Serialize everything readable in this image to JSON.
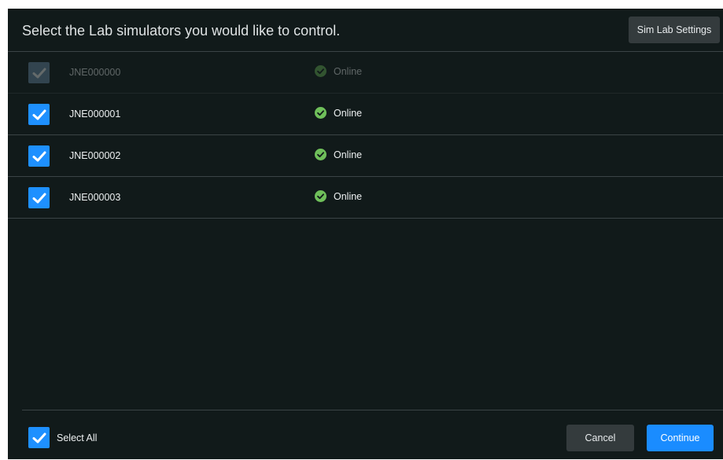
{
  "dialog": {
    "title": "Select the Lab simulators you would like to control.",
    "settings_label": "Sim Lab Settings"
  },
  "simulators": [
    {
      "id": "JNE000000",
      "status": "Online",
      "checked": true,
      "disabled": true
    },
    {
      "id": "JNE000001",
      "status": "Online",
      "checked": true,
      "disabled": false
    },
    {
      "id": "JNE000002",
      "status": "Online",
      "checked": true,
      "disabled": false
    },
    {
      "id": "JNE000003",
      "status": "Online",
      "checked": true,
      "disabled": false
    }
  ],
  "footer": {
    "select_all_label": "Select All",
    "select_all_checked": true,
    "cancel_label": "Cancel",
    "continue_label": "Continue"
  },
  "icons": {
    "checkbox": "checkmark-icon",
    "status": "check-circle-icon"
  },
  "colors": {
    "background": "#111a1a",
    "accent": "#1e90ff",
    "online": "#6fbf5a"
  }
}
